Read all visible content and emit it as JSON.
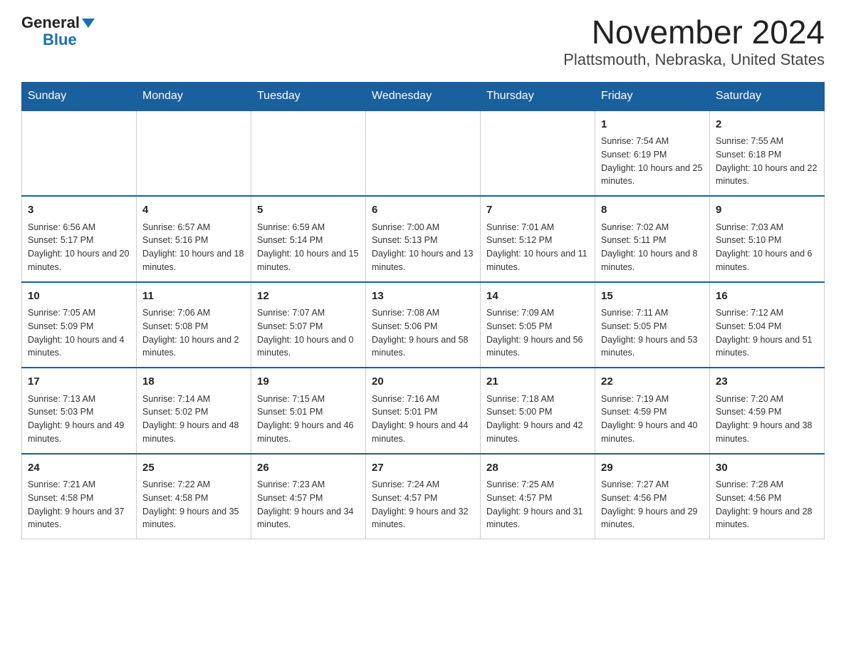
{
  "header": {
    "logo_general": "General",
    "logo_blue": "Blue",
    "title": "November 2024",
    "subtitle": "Plattsmouth, Nebraska, United States"
  },
  "weekdays": [
    "Sunday",
    "Monday",
    "Tuesday",
    "Wednesday",
    "Thursday",
    "Friday",
    "Saturday"
  ],
  "weeks": [
    [
      {
        "day": "",
        "info": ""
      },
      {
        "day": "",
        "info": ""
      },
      {
        "day": "",
        "info": ""
      },
      {
        "day": "",
        "info": ""
      },
      {
        "day": "",
        "info": ""
      },
      {
        "day": "1",
        "info": "Sunrise: 7:54 AM\nSunset: 6:19 PM\nDaylight: 10 hours and 25 minutes."
      },
      {
        "day": "2",
        "info": "Sunrise: 7:55 AM\nSunset: 6:18 PM\nDaylight: 10 hours and 22 minutes."
      }
    ],
    [
      {
        "day": "3",
        "info": "Sunrise: 6:56 AM\nSunset: 5:17 PM\nDaylight: 10 hours and 20 minutes."
      },
      {
        "day": "4",
        "info": "Sunrise: 6:57 AM\nSunset: 5:16 PM\nDaylight: 10 hours and 18 minutes."
      },
      {
        "day": "5",
        "info": "Sunrise: 6:59 AM\nSunset: 5:14 PM\nDaylight: 10 hours and 15 minutes."
      },
      {
        "day": "6",
        "info": "Sunrise: 7:00 AM\nSunset: 5:13 PM\nDaylight: 10 hours and 13 minutes."
      },
      {
        "day": "7",
        "info": "Sunrise: 7:01 AM\nSunset: 5:12 PM\nDaylight: 10 hours and 11 minutes."
      },
      {
        "day": "8",
        "info": "Sunrise: 7:02 AM\nSunset: 5:11 PM\nDaylight: 10 hours and 8 minutes."
      },
      {
        "day": "9",
        "info": "Sunrise: 7:03 AM\nSunset: 5:10 PM\nDaylight: 10 hours and 6 minutes."
      }
    ],
    [
      {
        "day": "10",
        "info": "Sunrise: 7:05 AM\nSunset: 5:09 PM\nDaylight: 10 hours and 4 minutes."
      },
      {
        "day": "11",
        "info": "Sunrise: 7:06 AM\nSunset: 5:08 PM\nDaylight: 10 hours and 2 minutes."
      },
      {
        "day": "12",
        "info": "Sunrise: 7:07 AM\nSunset: 5:07 PM\nDaylight: 10 hours and 0 minutes."
      },
      {
        "day": "13",
        "info": "Sunrise: 7:08 AM\nSunset: 5:06 PM\nDaylight: 9 hours and 58 minutes."
      },
      {
        "day": "14",
        "info": "Sunrise: 7:09 AM\nSunset: 5:05 PM\nDaylight: 9 hours and 56 minutes."
      },
      {
        "day": "15",
        "info": "Sunrise: 7:11 AM\nSunset: 5:05 PM\nDaylight: 9 hours and 53 minutes."
      },
      {
        "day": "16",
        "info": "Sunrise: 7:12 AM\nSunset: 5:04 PM\nDaylight: 9 hours and 51 minutes."
      }
    ],
    [
      {
        "day": "17",
        "info": "Sunrise: 7:13 AM\nSunset: 5:03 PM\nDaylight: 9 hours and 49 minutes."
      },
      {
        "day": "18",
        "info": "Sunrise: 7:14 AM\nSunset: 5:02 PM\nDaylight: 9 hours and 48 minutes."
      },
      {
        "day": "19",
        "info": "Sunrise: 7:15 AM\nSunset: 5:01 PM\nDaylight: 9 hours and 46 minutes."
      },
      {
        "day": "20",
        "info": "Sunrise: 7:16 AM\nSunset: 5:01 PM\nDaylight: 9 hours and 44 minutes."
      },
      {
        "day": "21",
        "info": "Sunrise: 7:18 AM\nSunset: 5:00 PM\nDaylight: 9 hours and 42 minutes."
      },
      {
        "day": "22",
        "info": "Sunrise: 7:19 AM\nSunset: 4:59 PM\nDaylight: 9 hours and 40 minutes."
      },
      {
        "day": "23",
        "info": "Sunrise: 7:20 AM\nSunset: 4:59 PM\nDaylight: 9 hours and 38 minutes."
      }
    ],
    [
      {
        "day": "24",
        "info": "Sunrise: 7:21 AM\nSunset: 4:58 PM\nDaylight: 9 hours and 37 minutes."
      },
      {
        "day": "25",
        "info": "Sunrise: 7:22 AM\nSunset: 4:58 PM\nDaylight: 9 hours and 35 minutes."
      },
      {
        "day": "26",
        "info": "Sunrise: 7:23 AM\nSunset: 4:57 PM\nDaylight: 9 hours and 34 minutes."
      },
      {
        "day": "27",
        "info": "Sunrise: 7:24 AM\nSunset: 4:57 PM\nDaylight: 9 hours and 32 minutes."
      },
      {
        "day": "28",
        "info": "Sunrise: 7:25 AM\nSunset: 4:57 PM\nDaylight: 9 hours and 31 minutes."
      },
      {
        "day": "29",
        "info": "Sunrise: 7:27 AM\nSunset: 4:56 PM\nDaylight: 9 hours and 29 minutes."
      },
      {
        "day": "30",
        "info": "Sunrise: 7:28 AM\nSunset: 4:56 PM\nDaylight: 9 hours and 28 minutes."
      }
    ]
  ]
}
